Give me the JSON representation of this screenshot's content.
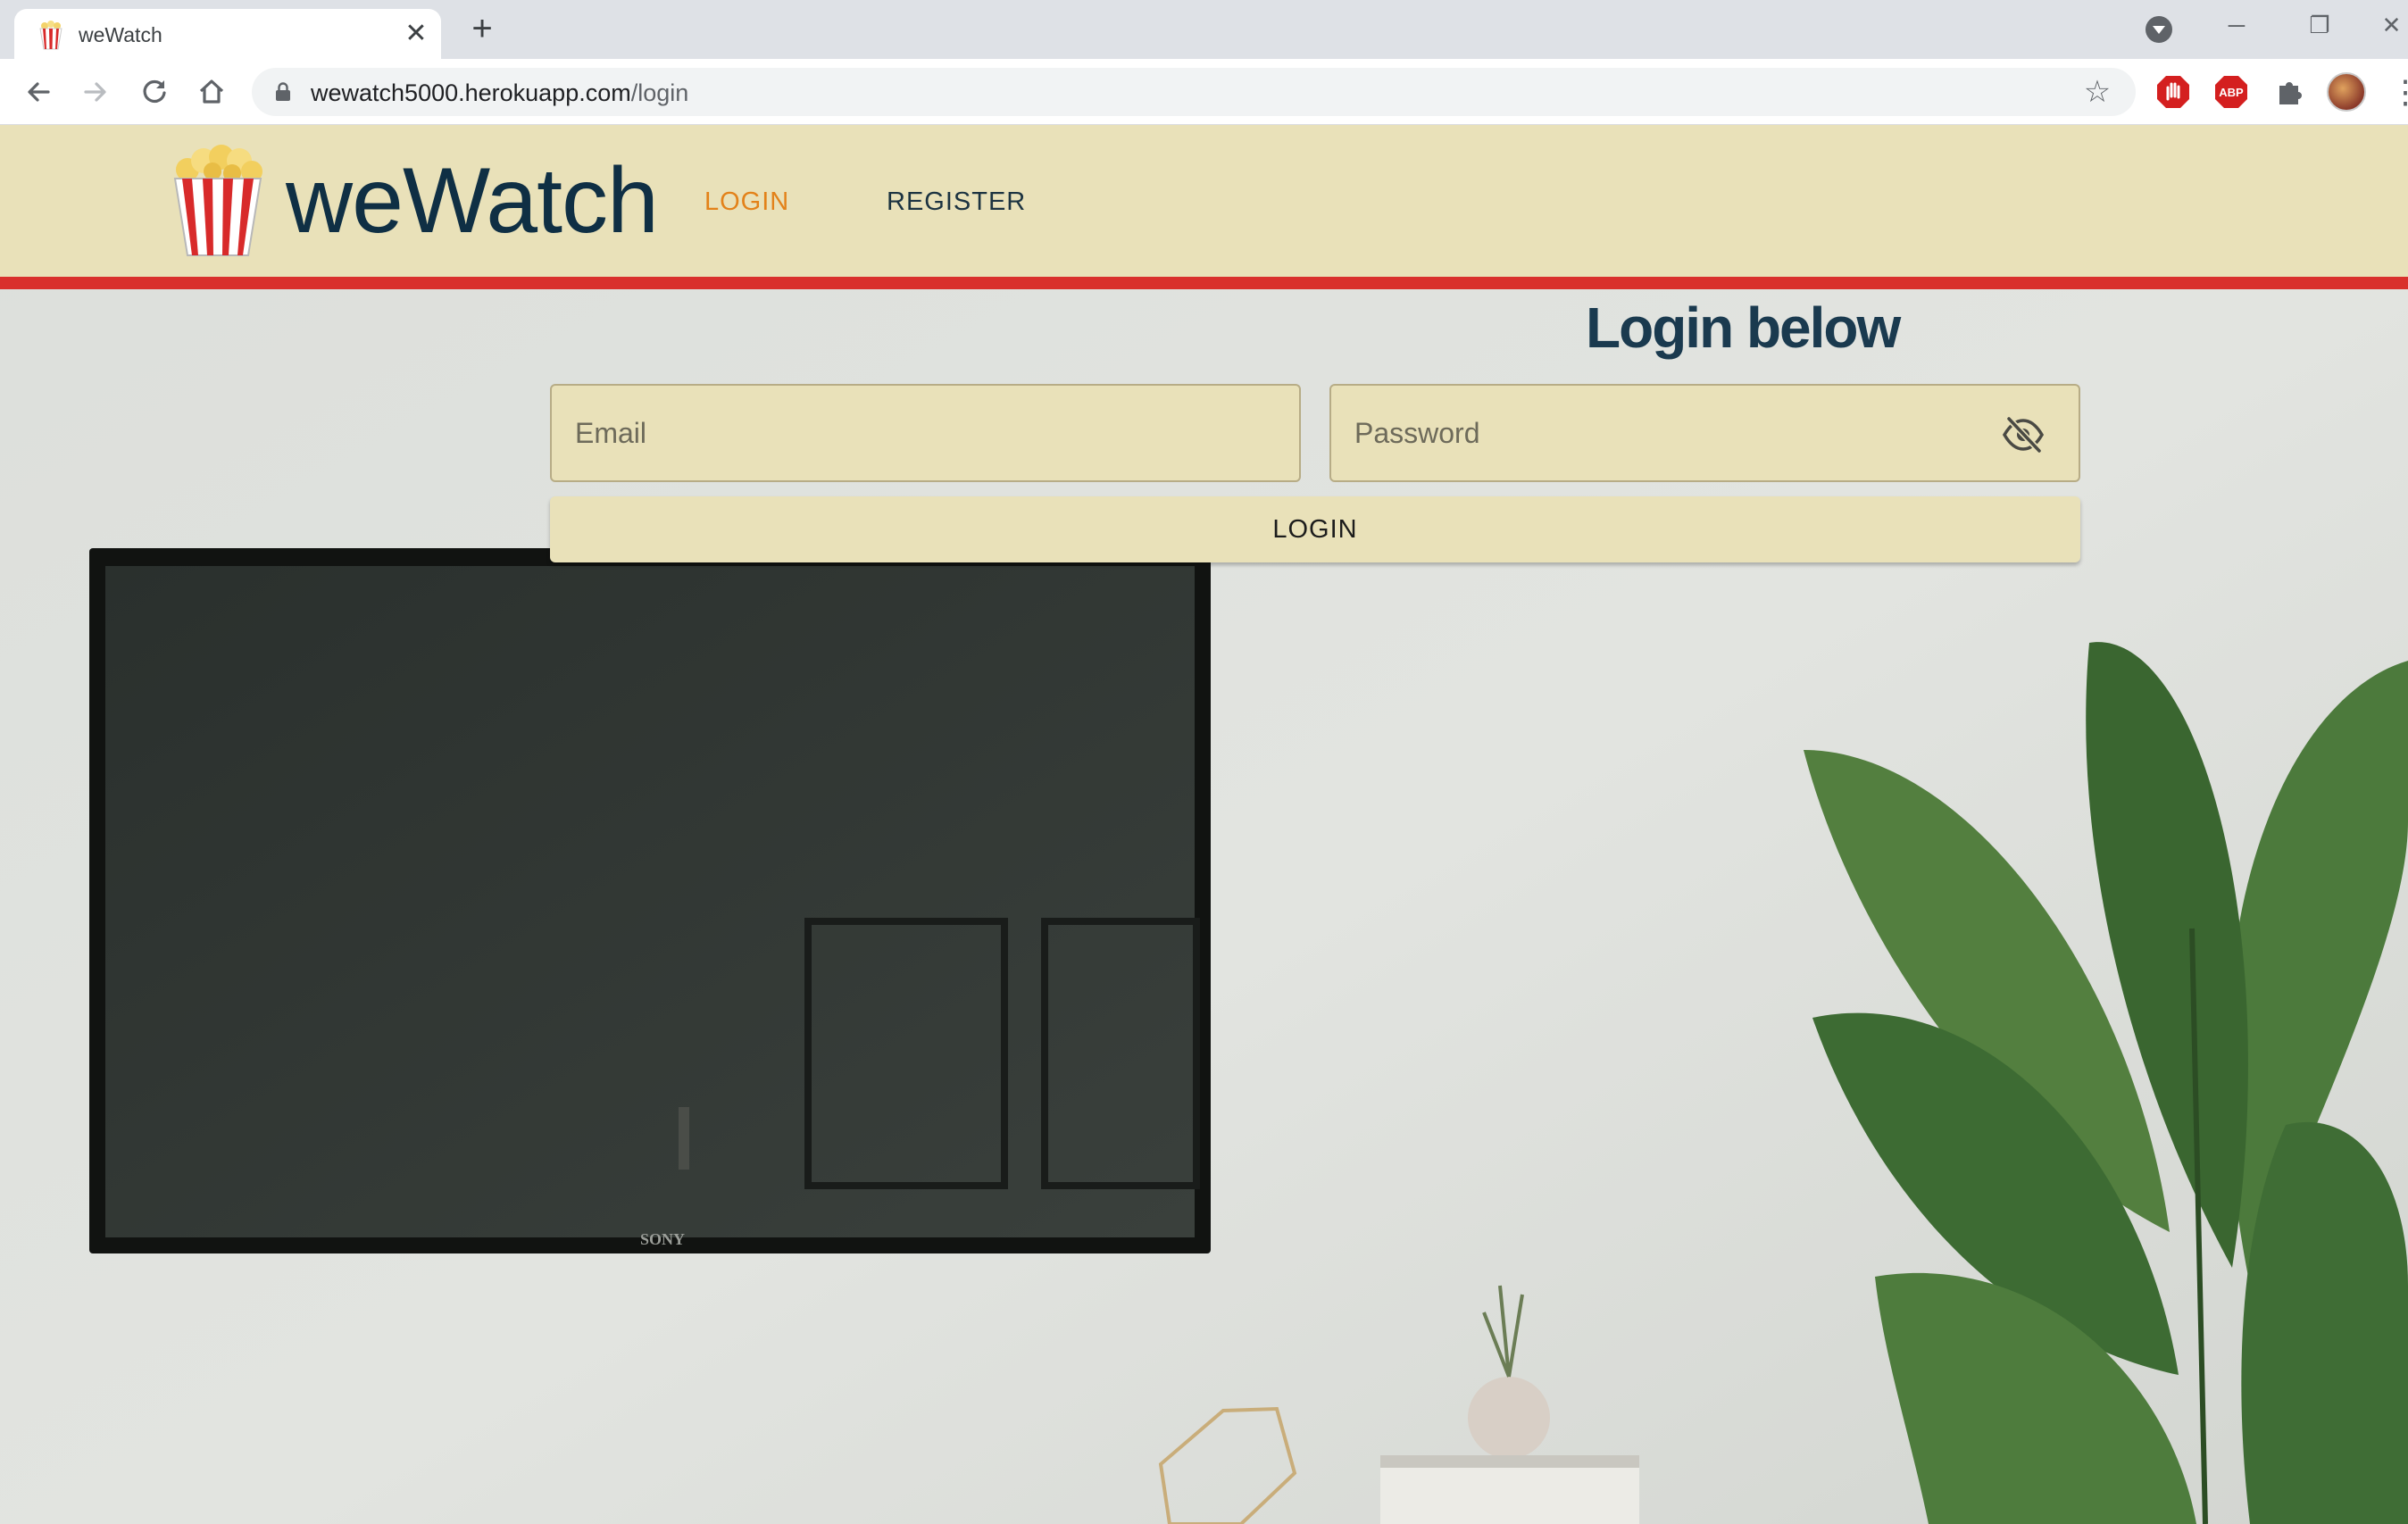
{
  "browser": {
    "tab_title": "weWatch",
    "tab_close": "✕",
    "new_tab": "+",
    "url_host": "wewatch5000.herokuapp.com",
    "url_path": "/login",
    "window_controls": {
      "minimize": "─",
      "maximize": "❐",
      "close": "✕"
    },
    "extensions": [
      "stop-icon",
      "adblock-plus-icon",
      "puzzle-icon",
      "profile-avatar"
    ],
    "icons": [
      "back-arrow-icon",
      "forward-arrow-icon",
      "reload-icon",
      "home-icon",
      "lock-icon",
      "star-icon",
      "menu-dots-icon"
    ]
  },
  "site": {
    "brand": "weWatch",
    "nav": {
      "login": "LOGIN",
      "register": "REGISTER"
    },
    "colors": {
      "header_bg": "#e9e1b9",
      "stripe": "#d9302c",
      "active_nav": "#e3821a",
      "brand_text": "#0f2f44"
    }
  },
  "login_form": {
    "heading_bold": "Login",
    "heading_rest": "below",
    "email_placeholder": "Email",
    "password_placeholder": "Password",
    "submit_label": "LOGIN"
  },
  "background_scene": {
    "tv_brand": "SONY"
  }
}
